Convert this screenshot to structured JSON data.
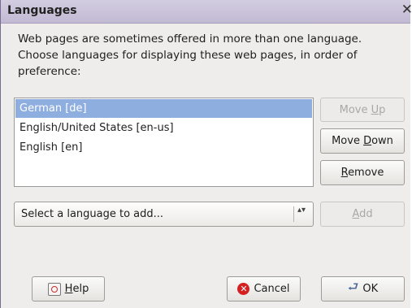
{
  "window": {
    "title": "Languages",
    "close_glyph": "✕"
  },
  "intro_text": "Web pages are sometimes offered in more than one language. Choose languages for displaying these web pages, in order of preference:",
  "languages": [
    {
      "label": "German  [de]",
      "selected": true
    },
    {
      "label": "English/United States  [en-us]",
      "selected": false
    },
    {
      "label": "English  [en]",
      "selected": false
    }
  ],
  "buttons": {
    "move_up": {
      "pre": "Move ",
      "mnemonic": "U",
      "post": "p",
      "enabled": false
    },
    "move_down": {
      "pre": "Move ",
      "mnemonic": "D",
      "post": "own",
      "enabled": true
    },
    "remove": {
      "pre": "",
      "mnemonic": "R",
      "post": "emove",
      "enabled": true
    },
    "add": {
      "pre": "",
      "mnemonic": "A",
      "post": "dd",
      "enabled": false
    },
    "help": {
      "pre": "",
      "mnemonic": "H",
      "post": "elp",
      "icon": "help-book-icon"
    },
    "cancel": {
      "label": "Cancel",
      "icon": "cancel-icon"
    },
    "ok": {
      "label": "OK",
      "icon": "ok-return-arrow-icon",
      "glyph": "⮐"
    }
  },
  "add_select": {
    "placeholder": "Select a language to add...",
    "arrow_glyphs": "▴▾"
  },
  "colors": {
    "selection": "#8faee0",
    "titlebar": "#c2bad4",
    "dialog_bg": "#eeedeb"
  }
}
